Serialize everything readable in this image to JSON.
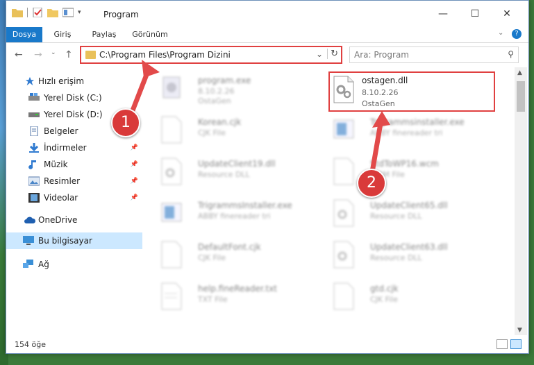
{
  "window": {
    "title": "Program"
  },
  "ribbon": {
    "tabs": [
      {
        "label": "Dosya",
        "active": true
      },
      {
        "label": "Giriş",
        "active": false
      },
      {
        "label": "Paylaş",
        "active": false
      },
      {
        "label": "Görünüm",
        "active": false
      }
    ]
  },
  "address": {
    "path": "C:\\Program Files\\Program Dizini"
  },
  "search": {
    "placeholder": "Ara: Program"
  },
  "sidebar": {
    "items": [
      {
        "label": "Hızlı erişim",
        "icon": "star-icon"
      },
      {
        "label": "Yerel Disk (C:)",
        "icon": "drive-icon"
      },
      {
        "label": "Yerel Disk (D:)",
        "icon": "drive-icon"
      },
      {
        "label": "Belgeler",
        "icon": "documents-icon"
      },
      {
        "label": "İndirmeler",
        "icon": "download-icon"
      },
      {
        "label": "Müzik",
        "icon": "music-icon"
      },
      {
        "label": "Resimler",
        "icon": "pictures-icon"
      },
      {
        "label": "Videolar",
        "icon": "video-icon"
      },
      {
        "label": "OneDrive",
        "icon": "cloud-icon"
      },
      {
        "label": "Bu bilgisayar",
        "icon": "computer-icon"
      },
      {
        "label": "Ağ",
        "icon": "network-icon"
      }
    ]
  },
  "files": [
    {
      "name": "program.exe",
      "line1": "8.10.2.26",
      "line2": "OstaGen"
    },
    {
      "name": "ostagen.dll",
      "line1": "8.10.2.26",
      "line2": "OstaGen"
    },
    {
      "name": "Korean.cjk",
      "line1": "CJK File",
      "line2": ""
    },
    {
      "name": "Trigrammsinstaller.exe",
      "line1": "ABBY finereader tri",
      "line2": ""
    },
    {
      "name": "UpdateClient19.dll",
      "line1": "Resource DLL",
      "line2": ""
    },
    {
      "name": "StdToWP16.wcm",
      "line1": "WCM File",
      "line2": ""
    },
    {
      "name": "TrigrammsInstaller.exe",
      "line1": "ABBY finereader tri",
      "line2": ""
    },
    {
      "name": "UpdateClient65.dll",
      "line1": "Resource DLL",
      "line2": ""
    },
    {
      "name": "DefaultFont.cjk",
      "line1": "CJK File",
      "line2": ""
    },
    {
      "name": "UpdateClient63.dll",
      "line1": "Resource DLL",
      "line2": ""
    },
    {
      "name": "help.fineReader.txt",
      "line1": "TXT File",
      "line2": ""
    },
    {
      "name": "gtd.cjk",
      "line1": "CJK File",
      "line2": ""
    }
  ],
  "annotations": {
    "step1": "1",
    "step2": "2"
  },
  "status": {
    "count": "154 öğe"
  },
  "colors": {
    "accent": "#1979ca",
    "highlight": "#e04040"
  }
}
